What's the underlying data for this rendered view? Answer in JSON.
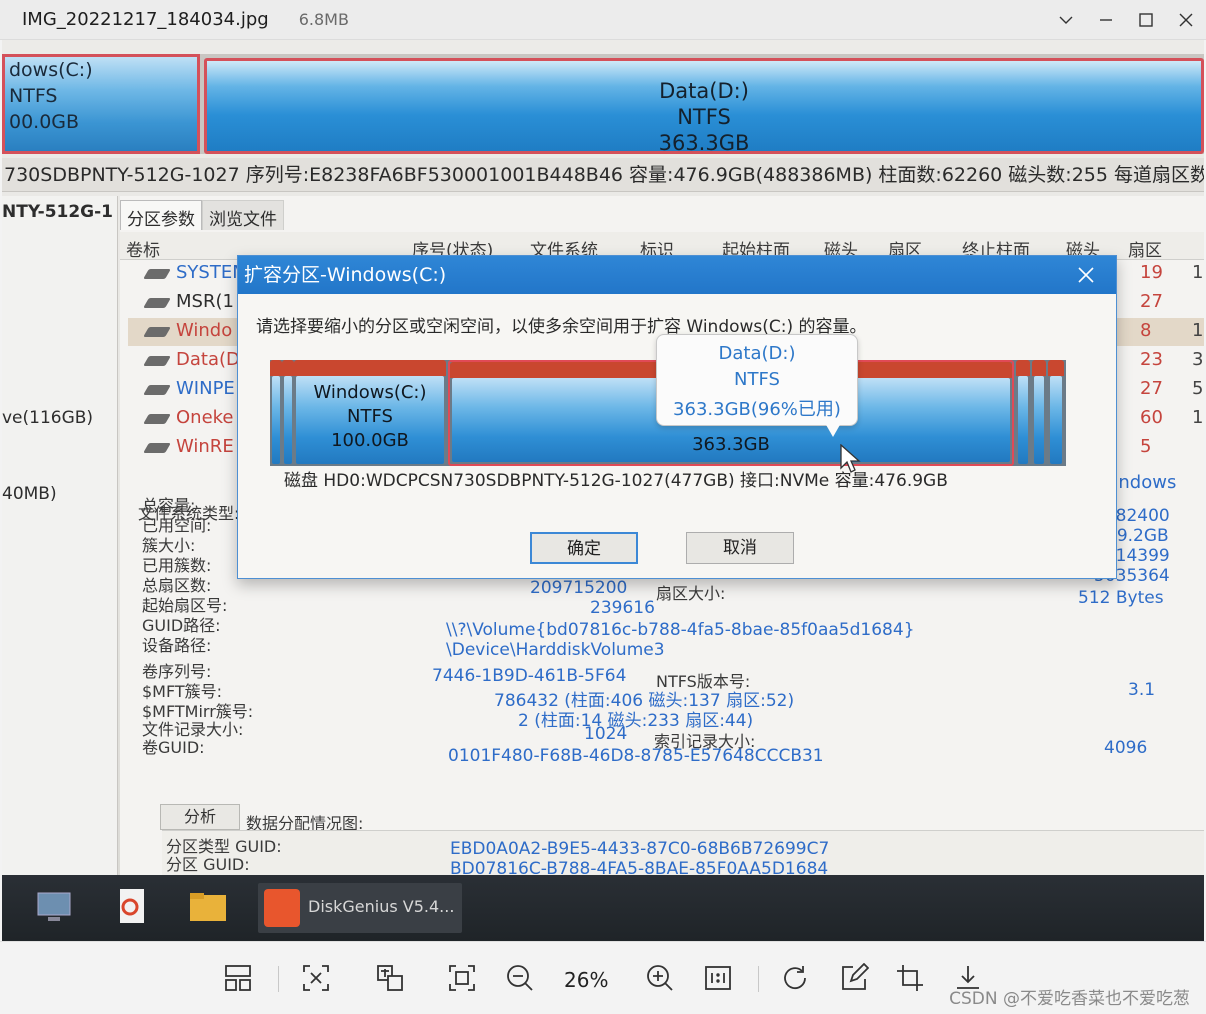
{
  "viewer": {
    "file_name": "IMG_20221217_184034.jpg",
    "file_size": "6.8MB",
    "zoom": "26%",
    "watermark": "CSDN @不爱吃香菜也不爱吃葱"
  },
  "diskmap": {
    "part_c": {
      "line1": "dows(C:)",
      "line2": "NTFS",
      "line3": "00.0GB"
    },
    "part_d": {
      "line1": "Data(D:)",
      "line2": "NTFS",
      "line3": "363.3GB"
    }
  },
  "disk_info": "730SDBPNTY-512G-1027  序列号:E8238FA6BF530001001B448B46  容量:476.9GB(488386MB)  柱面数:62260  磁头数:255  每道扇区数:63",
  "left_tree": {
    "item1": "NTY-512G-1",
    "item2": "ve(116GB)",
    "item3": "40MB)"
  },
  "tabs": [
    "分区参数",
    "浏览文件"
  ],
  "columns": [
    "卷标",
    "序号(状态)",
    "文件系统",
    "标识",
    "起始柱面",
    "磁头",
    "扇区",
    "终止柱面",
    "磁头",
    "扇区"
  ],
  "partitions": [
    {
      "name": "SYSTEM",
      "c1": "19",
      "c2": "1"
    },
    {
      "name": "MSR(1",
      "c1": "27",
      "c2": ""
    },
    {
      "name": "Windo",
      "c1": "8",
      "c2": "1"
    },
    {
      "name": "Data(D",
      "c1": "23",
      "c2": "3"
    },
    {
      "name": "WINPE",
      "c1": "27",
      "c2": "51"
    },
    {
      "name": "Oneke",
      "c1": "60",
      "c2": "1"
    },
    {
      "name": "WinRE",
      "c1": "5",
      "c2": ""
    }
  ],
  "details": {
    "fs_type_label": "文件系统类型:",
    "fs_type_value": "Windows",
    "labels": [
      "总容量:",
      "已用空间:",
      "簇大小:",
      "已用簇数:",
      "总扇区数:",
      "起始扇区号:",
      "GUID路径:",
      "设备路径:"
    ],
    "right_values": [
      "4182400",
      "19.2GB",
      "5214399",
      "5035364",
      "512 Bytes"
    ],
    "total_sectors": "209715200",
    "sector_size_label": "扇区大小:",
    "start_sector": "239616",
    "guid_path": "\\\\?\\Volume{bd07816c-b788-4fa5-8bae-85f0aa5d1684}",
    "device_path": "\\Device\\HarddiskVolume3",
    "labels2": [
      "卷序列号:",
      "$MFT簇号:",
      "$MFTMirr簇号:",
      "文件记录大小:",
      "卷GUID:"
    ],
    "serial": "7446-1B9D-461B-5F64",
    "ntfs_ver_label": "NTFS版本号:",
    "ntfs_ver": "3.1",
    "mft": "786432 (柱面:406 磁头:137 扇区:52)",
    "mftmirr": "2 (柱面:14 磁头:233 扇区:44)",
    "record_size": "1024",
    "index_label": "索引记录大小:",
    "index_size": "4096",
    "vol_guid": "0101F480-F68B-46D8-8785-E57648CCCB31",
    "analyze_btn": "分析",
    "dist_label": "数据分配情况图:",
    "ptype_label": "分区类型 GUID:",
    "ptype_value": "EBD0A0A2-B9E5-4433-87C0-68B6B72699C7",
    "pguid_label": "分区 GUID:",
    "pguid_value": "BD07816C-B788-4FA5-8BAE-85F0AA5D1684"
  },
  "taskbar": {
    "app_label": "DiskGenius V5.4..."
  },
  "dialog": {
    "title": "扩容分区-Windows(C:)",
    "message": "请选择要缩小的分区或空闲空间，以使多余空间用于扩容 Windows(C:) 的容量。",
    "seg_c": {
      "name": "Windows(C:)",
      "fs": "NTFS",
      "size": "100.0GB"
    },
    "seg_d": {
      "size": "363.3GB"
    },
    "tooltip": {
      "name": "Data(D:)",
      "fs": "NTFS",
      "size": "363.3GB(96%已用)"
    },
    "disk_line": "磁盘 HD0:WDCPCSN730SDBPNTY-512G-1027(477GB)  接口:NVMe  容量:476.9GB",
    "ok": "确定",
    "cancel": "取消"
  }
}
